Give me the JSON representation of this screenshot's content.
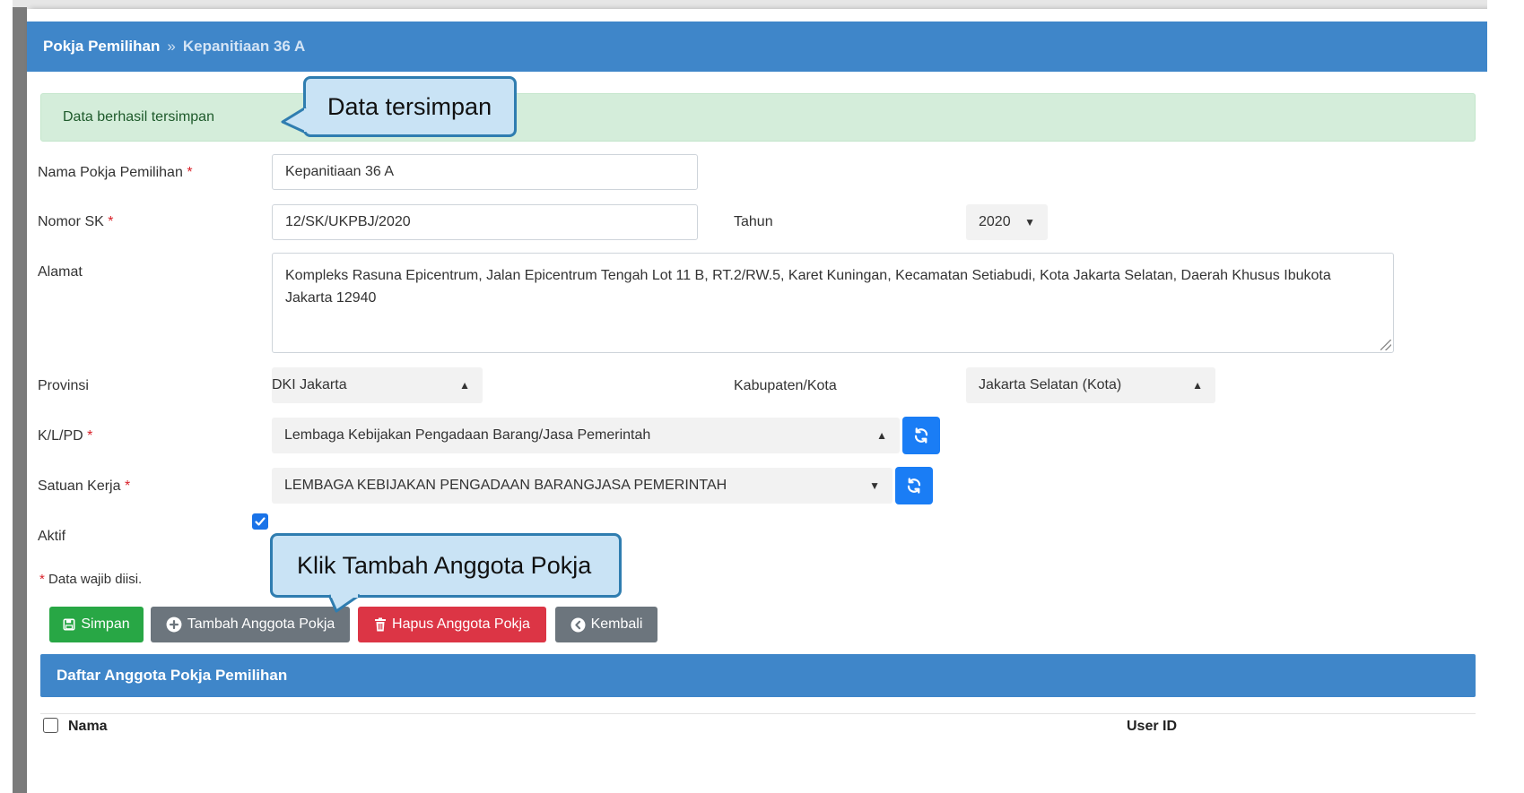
{
  "breadcrumb": {
    "parent": "Pokja Pemilihan",
    "separator": "»",
    "current": "Kepanitiaan 36 A"
  },
  "alert": {
    "message": "Data berhasil tersimpan"
  },
  "callouts": {
    "saved": "Data tersimpan",
    "add_member": "Klik Tambah Anggota Pokja"
  },
  "form": {
    "nama_label": "Nama Pokja Pemilihan",
    "nama_value": "Kepanitiaan 36 A",
    "nomor_sk_label": "Nomor SK",
    "nomor_sk_value": "12/SK/UKPBJ/2020",
    "tahun_label": "Tahun",
    "tahun_value": "2020",
    "alamat_label": "Alamat",
    "alamat_value": "Kompleks Rasuna Epicentrum, Jalan Epicentrum Tengah Lot 11 B, RT.2/RW.5, Karet Kuningan, Kecamatan Setiabudi, Kota Jakarta Selatan, Daerah Khusus Ibukota Jakarta 12940",
    "provinsi_label": "Provinsi",
    "provinsi_value": "DKI Jakarta",
    "kabupaten_label": "Kabupaten/Kota",
    "kabupaten_value": "Jakarta Selatan (Kota)",
    "klpd_label": "K/L/PD",
    "klpd_value": "Lembaga Kebijakan Pengadaan Barang/Jasa Pemerintah",
    "satker_label": "Satuan Kerja",
    "satker_value": "LEMBAGA KEBIJAKAN PENGADAAN BARANGJASA PEMERINTAH",
    "aktif_label": "Aktif",
    "aktif_checked": true,
    "required_marker": "*",
    "required_note": "Data wajib diisi."
  },
  "buttons": {
    "simpan": "Simpan",
    "tambah": "Tambah Anggota Pokja",
    "hapus": "Hapus Anggota Pokja",
    "kembali": "Kembali"
  },
  "table": {
    "title": "Daftar Anggota Pokja Pemilihan",
    "columns": [
      "Nama",
      "User ID"
    ]
  },
  "colors": {
    "primary_bar": "#3f86c9",
    "success": "#28a745",
    "secondary": "#6c757d",
    "danger": "#dc3545",
    "icon_button": "#1a7df5",
    "callout_fill": "#c9e3f5",
    "callout_border": "#2f7db0"
  },
  "icons": {
    "simpan": "save-icon",
    "tambah": "plus-circle-icon",
    "hapus": "trash-icon",
    "kembali": "arrow-left-circle-icon",
    "refresh": "refresh-icon"
  }
}
